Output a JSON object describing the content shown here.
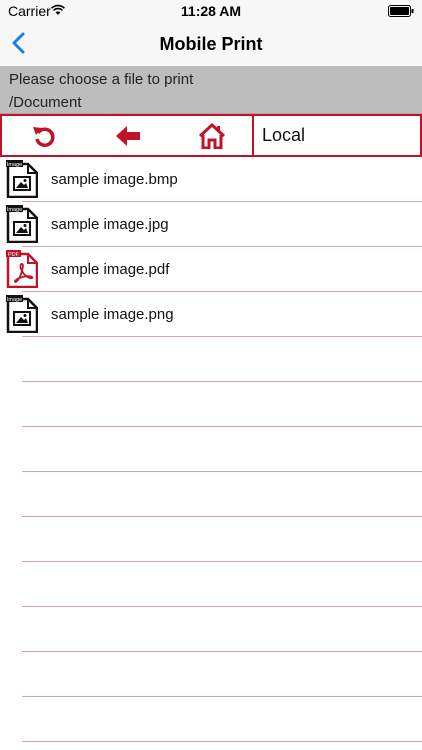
{
  "status": {
    "carrier": "Carrier",
    "time": "11:28 AM"
  },
  "nav": {
    "title": "Mobile Print"
  },
  "info": {
    "message": "Please choose a file to print",
    "path": "/Document"
  },
  "toolbar": {
    "location": "Local"
  },
  "files": [
    {
      "name": "sample image.bmp",
      "badge": "Image",
      "type": "image"
    },
    {
      "name": "sample image.jpg",
      "badge": "Image",
      "type": "image"
    },
    {
      "name": "sample image.pdf",
      "badge": "PDF",
      "type": "pdf"
    },
    {
      "name": "sample image.png",
      "badge": "Image",
      "type": "image"
    }
  ],
  "colors": {
    "accent": "#c21228",
    "ios_blue": "#1a7cf5",
    "info_bg": "#bdbdbd",
    "divider": "#e39ea5"
  }
}
